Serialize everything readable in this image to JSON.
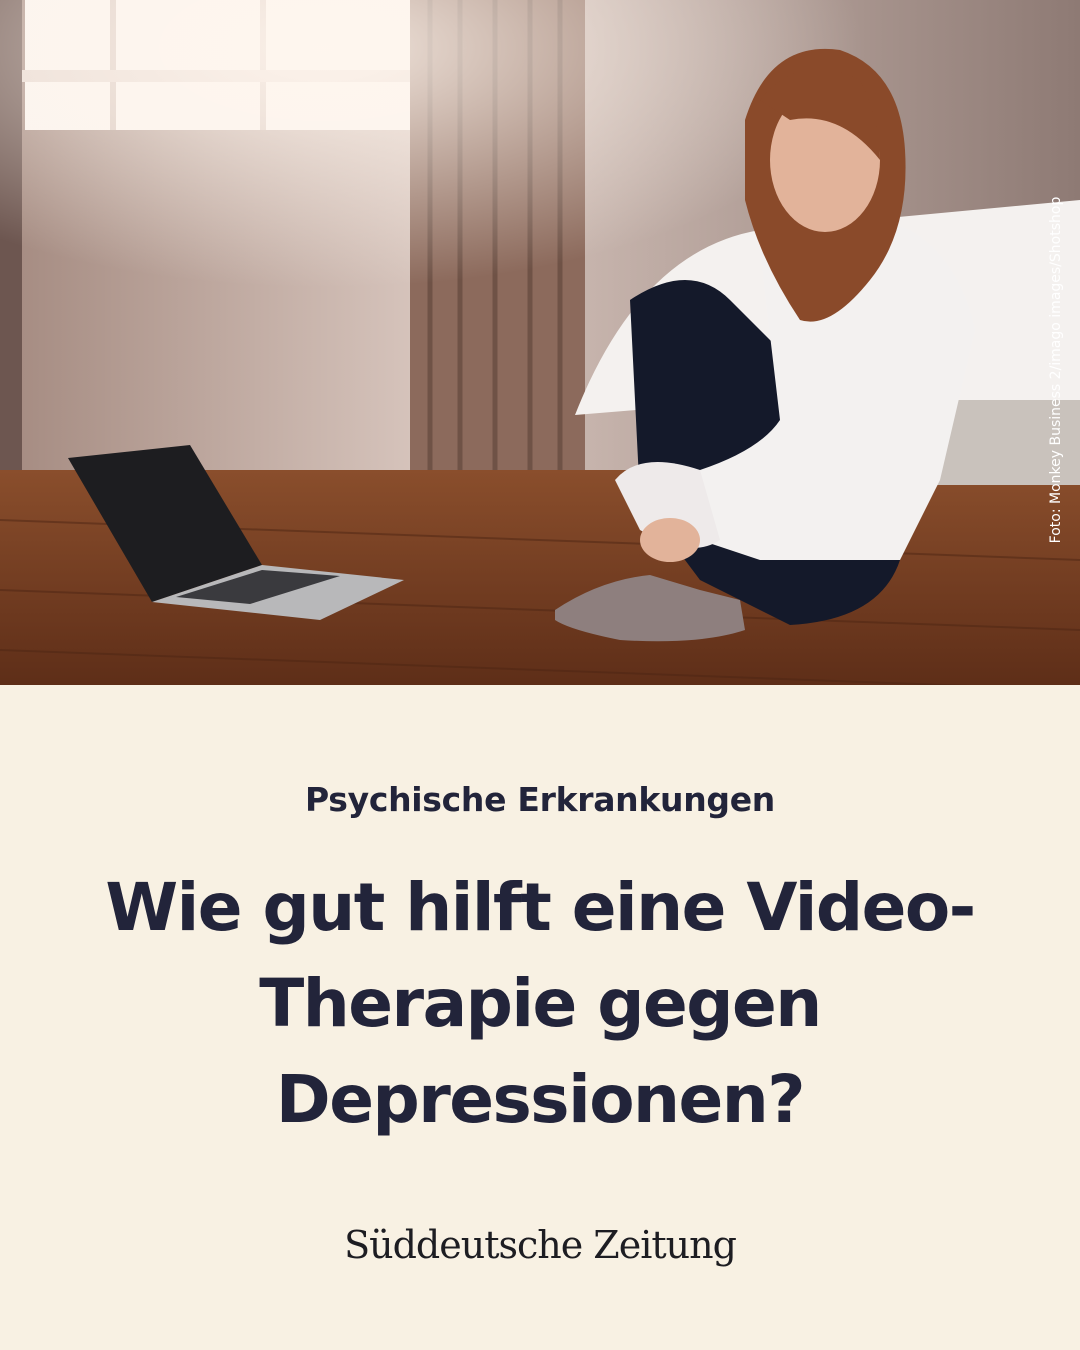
{
  "photo": {
    "credit": "Foto: Monkey Business 2/imago images/Shotshop"
  },
  "article": {
    "kicker": "Psychische Erkrankungen",
    "headline": "Wie gut hilft eine Video-Therapie gegen Depressionen?"
  },
  "brand": {
    "logo_text": "Süddeutsche Zeitung"
  },
  "colors": {
    "background": "#f8f1e3",
    "text": "#22243a"
  }
}
